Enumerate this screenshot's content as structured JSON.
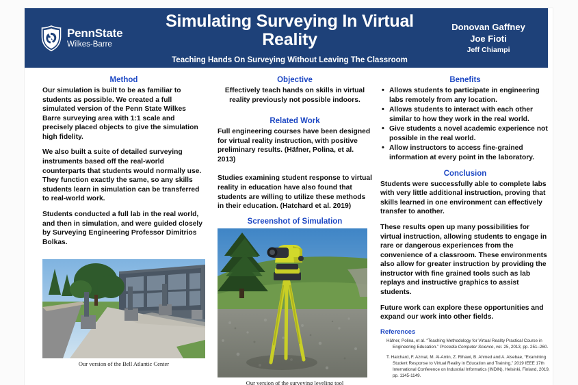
{
  "header": {
    "logo": {
      "name": "PennState",
      "campus": "Wilkes-Barre",
      "icon": "penn-state-shield-lion-icon"
    },
    "title": "Simulating Surveying In Virtual Reality",
    "subtitle": "Teaching Hands On Surveying Without Leaving The Classroom",
    "authors": [
      "Donovan Gaffney",
      "Joe Fioti",
      "Jeff Chiampi"
    ],
    "bg_color": "#1e4179"
  },
  "theme": {
    "heading_blue": "#1f49c4",
    "header_blue": "#1e4179",
    "body_text": "#111111"
  },
  "left_column": {
    "heading": "Method",
    "paragraphs": [
      "Our simulation is built to be as familiar to students as possible. We created a full simulated version of the Penn State Wilkes Barre surveying area with 1:1 scale and precisely placed objects to give the simulation high fidelity.",
      "We also built a suite of detailed surveying instruments based off the real-world counterparts that students would normally use. They function exactly the same, so any skills students learn in simulation can be transferred to real-world work.",
      "Students conducted a full lab in the real world, and then in simulation, and were guided closely by Surveying Engineering Professor Dimitrios Bolkas."
    ],
    "figure": {
      "caption": "Our version of the Bell Atlantic Center",
      "alt": "screenshot-bell-atlantic-center"
    }
  },
  "middle_column": {
    "objective": {
      "heading": "Objective",
      "text": "Effectively teach hands on skills in virtual reality previously not possible indoors."
    },
    "related_work": {
      "heading": "Related Work",
      "paragraphs": [
        "Full engineering courses have been designed for virtual reality instruction, with positive preliminary results. (Häfner, Polina, et al. 2013)",
        "Studies examining student response to virtual reality in education have also found that students are willing to utilize these methods in their education. (Hatchard et al. 2019)"
      ]
    },
    "screenshot": {
      "heading": "Screenshot of Simulation",
      "caption": "Our version of the surveying leveling tool",
      "alt": "screenshot-surveying-leveling-tool"
    }
  },
  "right_column": {
    "benefits": {
      "heading": "Benefits",
      "items": [
        "Allows students to participate in engineering labs remotely from any location.",
        "Allows students to interact with each other similar to how they work in the real world.",
        "Give students a novel academic experience not possible in the real world.",
        "Allow instructors to access fine-grained information at every point in the laboratory."
      ]
    },
    "conclusion": {
      "heading": "Conclusion",
      "paragraphs": [
        "Students were successfully able to complete labs with very little additional instruction, proving that skills learned in one environment can effectively transfer to another.",
        "These results open up many possibilities for virtual instruction, allowing students to engage in rare or dangerous experiences from the convenience of a classroom. These environments also allow for greater instruction by providing the instructor with fine grained tools such as lab replays and instructive graphics to assist students.",
        "Future work can explore these opportunities and expand our work into other fields."
      ]
    },
    "references": {
      "heading": "References",
      "items": [
        {
          "plain_1": "Häfner, Polina, et al. “Teaching Methodology for Virtual Reality Practical Course in Engineering Education.” ",
          "italic": "Procedia Computer Science",
          "plain_2": ", vol. 25, 2013, pp. 251–260."
        },
        {
          "plain_1": "T. Hatchard, F. Azmat, M. Al-Amin, Z. Rihawi, B. Ahmed and A. Alsebae, “Examining Student Response to Virtual Reality in Education and Training,” 2019 IEEE 17th International Conference on Industrial Informatics (INDIN), Helsinki, Finland, 2019, pp. 1145-1149.",
          "italic": "",
          "plain_2": ""
        }
      ]
    }
  }
}
